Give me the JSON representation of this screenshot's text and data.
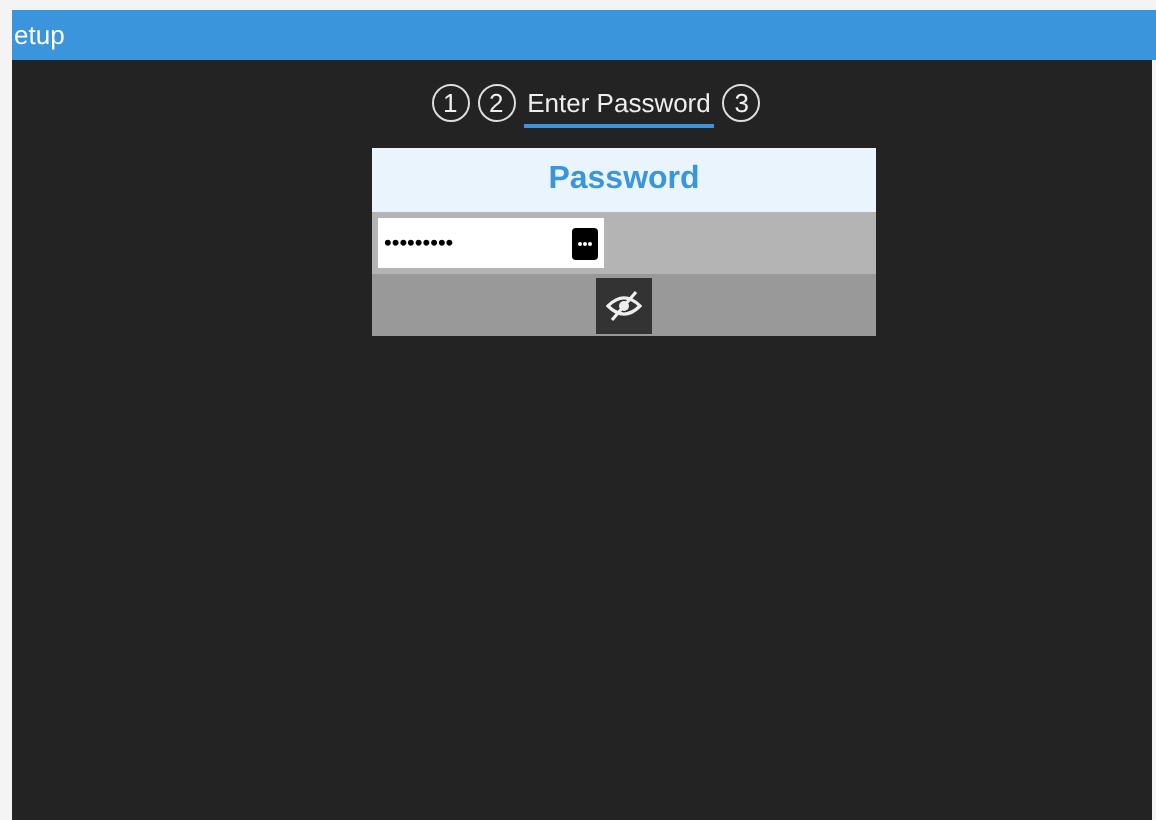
{
  "header": {
    "title": "etup"
  },
  "steps": [
    {
      "label": "1",
      "selected": false
    },
    {
      "label": "2",
      "selected": false
    },
    {
      "label": "Enter Password",
      "selected": true
    },
    {
      "label": "3",
      "selected": false
    }
  ],
  "card": {
    "title": "Password",
    "password_value": "•••••••••",
    "reveal": false
  }
}
